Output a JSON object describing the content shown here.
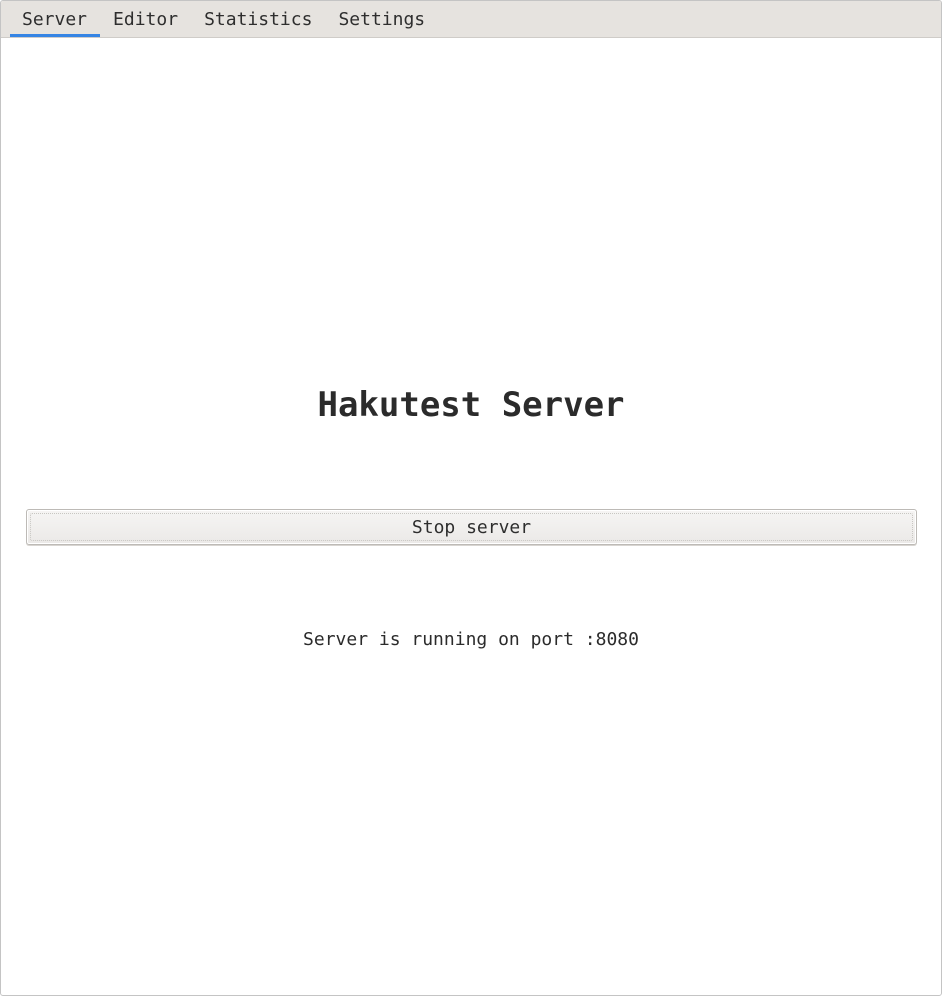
{
  "tabs": [
    {
      "label": "Server",
      "active": true
    },
    {
      "label": "Editor",
      "active": false
    },
    {
      "label": "Statistics",
      "active": false
    },
    {
      "label": "Settings",
      "active": false
    }
  ],
  "main": {
    "title": "Hakutest Server",
    "stop_button_label": "Stop server",
    "status_text": "Server is running on port :8080"
  },
  "colors": {
    "accent": "#3584e4",
    "tabbar_bg": "#e6e3df",
    "text": "#2b2b2b"
  }
}
